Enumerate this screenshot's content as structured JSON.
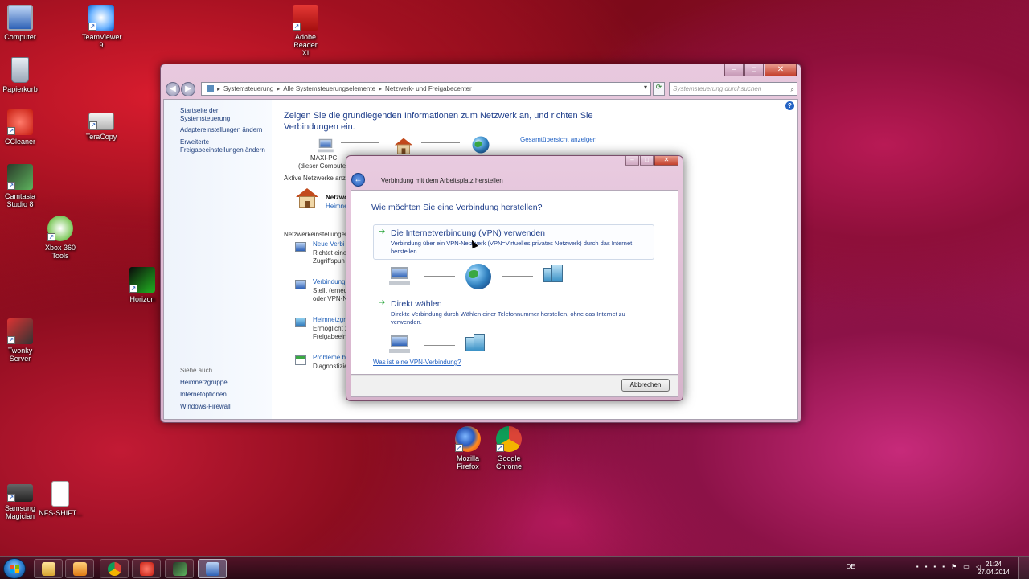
{
  "desktop": {
    "icons": [
      {
        "label": "Computer"
      },
      {
        "label": "Papierkorb"
      },
      {
        "label": "CCleaner"
      },
      {
        "label": "Camtasia Studio 8"
      },
      {
        "label": "Xbox 360 Tools"
      },
      {
        "label": "Twonky Server"
      },
      {
        "label": "Samsung Magician"
      },
      {
        "label": "TeamViewer 9"
      },
      {
        "label": "TeraCopy"
      },
      {
        "label": "Horizon"
      },
      {
        "label": "Adobe Reader XI"
      },
      {
        "label": "NFS-SHIFT..."
      },
      {
        "label": "Mozilla Firefox"
      },
      {
        "label": "Google Chrome"
      }
    ]
  },
  "explorer": {
    "controls": {
      "minimize": "–",
      "maximize": "□",
      "close": "✕"
    },
    "breadcrumb": [
      "Systemsteuerung",
      "Alle Systemsteuerungselemente",
      "Netzwerk- und Freigabecenter"
    ],
    "breadcrumb_sep": "▸",
    "search_placeholder": "Systemsteuerung durchsuchen",
    "left_pane": {
      "home": "Startseite der Systemsteuerung",
      "adapter": "Adaptereinstellungen ändern",
      "advanced_1": "Erweiterte",
      "advanced_2": "Freigabeeinstellungen ändern",
      "see_also": "Siehe auch",
      "homegroup": "Heimnetzgruppe",
      "internet_options": "Internetoptionen",
      "firewall": "Windows-Firewall"
    },
    "main": {
      "title_line1": "Zeigen Sie die grundlegenden Informationen zum Netzwerk an, und richten Sie",
      "title_line2": "Verbindungen ein.",
      "overview_link": "Gesamtübersicht anzeigen",
      "pc_name": "MAXI-PC",
      "pc_sub": "(dieser Computer",
      "active_networks": "Aktive Netzwerke anz",
      "network_name": "Netzwo",
      "network_type": "Heimne",
      "settings_header": "Netzwerkeinstellungen",
      "items": [
        {
          "title": "Neue Verbi",
          "desc1": "Richtet eine",
          "desc2": "Zugriffspun"
        },
        {
          "title": "Verbindung",
          "desc1": "Stellt (erneu",
          "desc2": "oder VPN-N"
        },
        {
          "title": "Heimnetzgr",
          "desc1": "Ermöglicht z",
          "desc2": "Freigabeein"
        },
        {
          "title": "Probleme b",
          "desc1": "Diagnostizie",
          "desc2": ""
        }
      ]
    }
  },
  "dialog": {
    "controls": {
      "minimize": "–",
      "maximize": "□",
      "close": "✕"
    },
    "title": "Verbindung mit dem Arbeitsplatz herstellen",
    "question": "Wie möchten Sie eine Verbindung herstellen?",
    "option_vpn": {
      "header": "Die Internetverbindung (VPN) verwenden",
      "desc_line1": "Verbindung über ein VPN-Netzwerk (VPN=Virtuelles privates Netzwerk) durch das Internet",
      "desc_line2": "herstellen."
    },
    "option_direct": {
      "header": "Direkt wählen",
      "desc_line1": "Direkte Verbindung durch Wählen einer Telefonnummer herstellen, ohne das Internet zu",
      "desc_line2": "verwenden."
    },
    "help_link": "Was ist eine VPN-Verbindung?",
    "cancel": "Abbrechen"
  },
  "taskbar": {
    "language": "DE",
    "time": "21:24",
    "date": "27.04.2014"
  }
}
